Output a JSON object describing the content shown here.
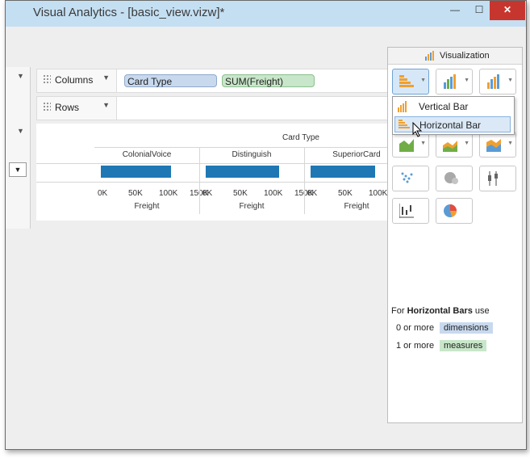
{
  "window": {
    "title": "Visual Analytics - [basic_view.vizw]*",
    "min_label": "—",
    "max_label": "☐",
    "close_label": "✕"
  },
  "shelves": {
    "columns_label": "Columns",
    "rows_label": "Rows",
    "column_pills": [
      {
        "label": "Card Type",
        "kind": "dimension"
      },
      {
        "label": "SUM(Freight)",
        "kind": "measure"
      }
    ]
  },
  "chart_data": {
    "type": "bar",
    "orientation": "horizontal",
    "title": "Card Type",
    "categories": [
      "ColonialVoice",
      "Distinguish",
      "SuperiorCard"
    ],
    "values": [
      115000,
      120000,
      105000
    ],
    "xlabel": "Freight",
    "xlim": [
      0,
      150000
    ],
    "tick_labels": [
      "0K",
      "50K",
      "100K",
      "150K"
    ],
    "bar_color": "#1f77b4"
  },
  "panel": {
    "title": "Visualization",
    "menu": {
      "items": [
        "Vertical Bar",
        "Horizontal Bar"
      ],
      "hovered": "Horizontal Bar"
    },
    "hint": {
      "prefix": "For ",
      "bold": "Horizontal Bars",
      "suffix": " use",
      "rows": [
        {
          "count": "0 or more",
          "tag": "dimensions",
          "color": "#c8d9ee"
        },
        {
          "count": "1 or more",
          "tag": "measures",
          "color": "#c8e6c9"
        }
      ]
    }
  }
}
